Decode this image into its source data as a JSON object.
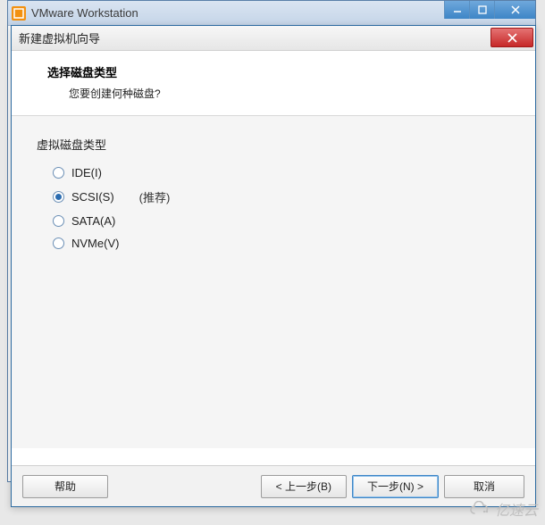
{
  "outerWindow": {
    "title": "VMware Workstation"
  },
  "dialog": {
    "title": "新建虚拟机向导",
    "heading": "选择磁盘类型",
    "subheading": "您要创建何种磁盘?",
    "groupLabel": "虚拟磁盘类型",
    "options": [
      {
        "label": "IDE(I)",
        "hint": "",
        "checked": false
      },
      {
        "label": "SCSI(S)",
        "hint": "(推荐)",
        "checked": true
      },
      {
        "label": "SATA(A)",
        "hint": "",
        "checked": false
      },
      {
        "label": "NVMe(V)",
        "hint": "",
        "checked": false
      }
    ],
    "buttons": {
      "help": "帮助",
      "back": "< 上一步(B)",
      "next": "下一步(N) >",
      "cancel": "取消"
    }
  },
  "watermark": "亿速云"
}
